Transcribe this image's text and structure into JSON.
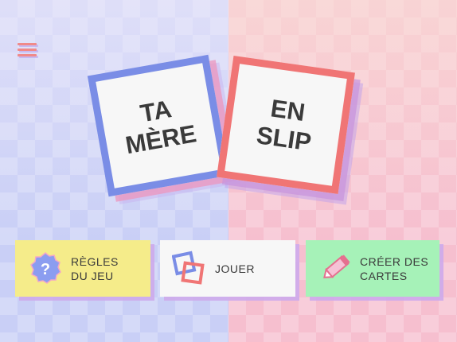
{
  "title_cards": {
    "left": "TA\nMÈRE",
    "right": "EN\nSLIP"
  },
  "buttons": {
    "rules": "RÈGLES\nDU JEU",
    "play": "JOUER",
    "create": "CRÉER DES\nCARTES"
  },
  "icons": {
    "menu": "hamburger-menu-icon",
    "rules": "question-badge-icon",
    "play": "overlapping-squares-icon",
    "create": "pencil-icon"
  },
  "colors": {
    "left_bg": "#c9cff6",
    "right_bg": "#f6bfcf",
    "card_left_border": "#7a8de6",
    "card_right_border": "#f07575",
    "rules_button": "#f5ec8a",
    "play_button": "#f7f7f7",
    "create_button": "#a6f2b8"
  }
}
